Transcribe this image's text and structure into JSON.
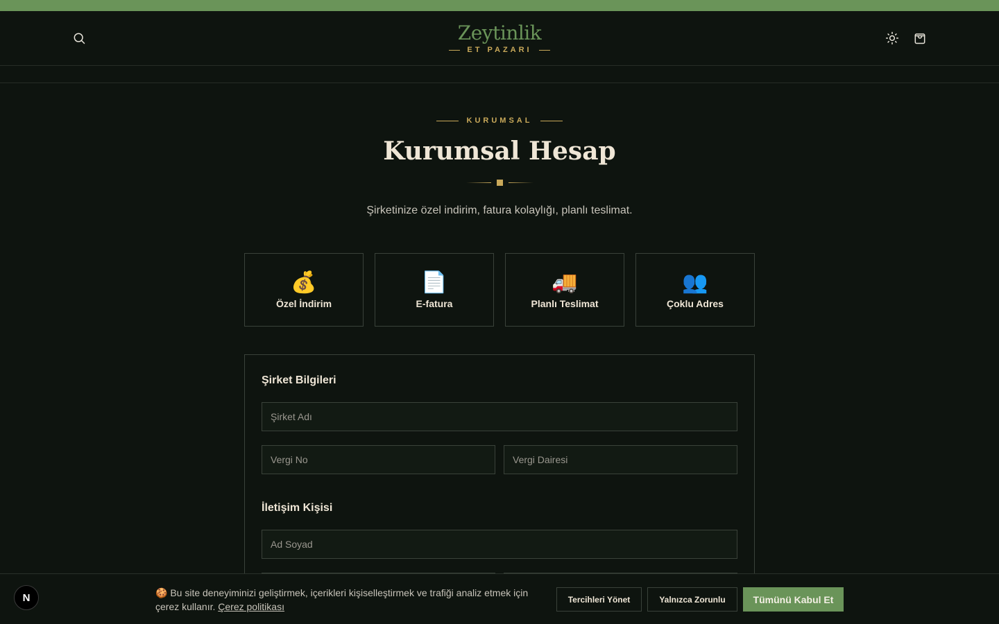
{
  "header": {
    "logo_title": "Zeytinlik",
    "logo_subtitle": "ET PAZARI",
    "icons": [
      "search-icon",
      "sun-icon",
      "shopping-bag-icon"
    ]
  },
  "hero": {
    "eyebrow": "KURUMSAL",
    "title": "Kurumsal Hesap",
    "subtitle": "Şirketinize özel indirim, fatura kolaylığı, planlı teslimat."
  },
  "features": [
    {
      "emoji": "💰",
      "label": "Özel İndirim"
    },
    {
      "emoji": "📄",
      "label": "E-fatura"
    },
    {
      "emoji": "🚚",
      "label": "Planlı Teslimat"
    },
    {
      "emoji": "👥",
      "label": "Çoklu Adres"
    }
  ],
  "form": {
    "company_section": "Şirket Bilgileri",
    "company_name_placeholder": "Şirket Adı",
    "tax_no_placeholder": "Vergi No",
    "tax_office_placeholder": "Vergi Dairesi",
    "contact_section": "İletişim Kişisi",
    "full_name_placeholder": "Ad Soyad"
  },
  "cookie": {
    "text": "🍪 Bu site deneyiminizi geliştirmek, içerikleri kişiselleştirmek ve trafiği analiz etmek için çerez kullanır.",
    "policy_link": "Çerez politikası",
    "manage_label": "Tercihleri Yönet",
    "necessary_label": "Yalnızca Zorunlu",
    "accept_all_label": "Tümünü Kabul Et"
  },
  "dev_badge": "N",
  "colors": {
    "accent_green": "#6a9459",
    "gold": "#c9a95a",
    "background": "#0e140f"
  }
}
